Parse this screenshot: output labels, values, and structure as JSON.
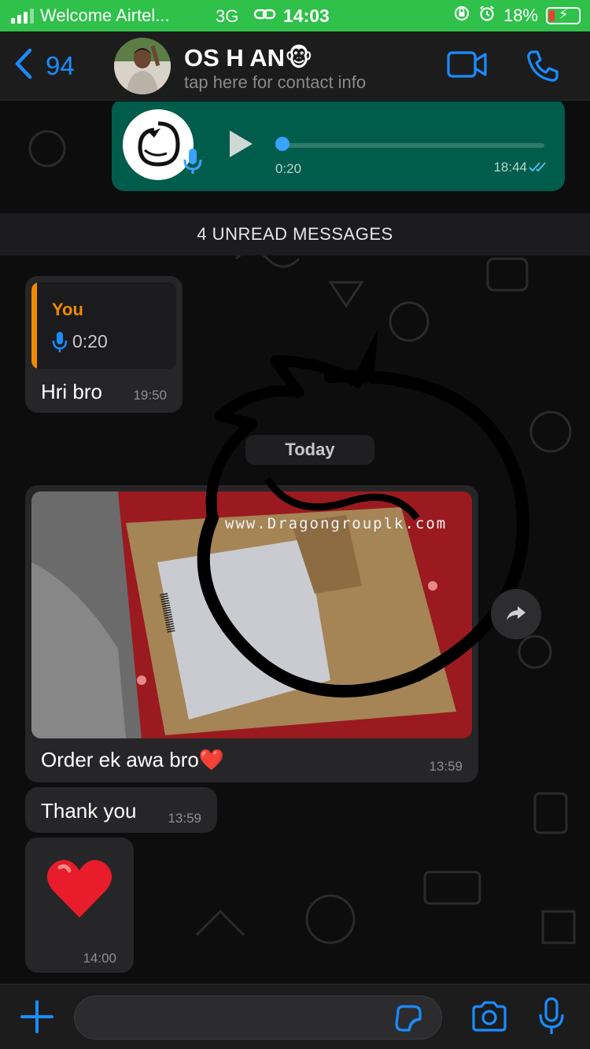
{
  "status_bar": {
    "carrier": "Welcome Airtel...",
    "network": "3G",
    "time": "14:03",
    "battery": "18%"
  },
  "header": {
    "back_count": "94",
    "contact_name": "OS H AN🐵",
    "subtitle": "tap here for contact info"
  },
  "messages": {
    "voice_out": {
      "duration": "0:20",
      "time": "18:44"
    },
    "unread_banner": "4 UNREAD MESSAGES",
    "reply": {
      "quote_author": "You",
      "quote_duration": "0:20",
      "text": "Hri bro",
      "time": "19:50"
    },
    "date_separator": "Today",
    "photo": {
      "watermark": "www.Dragongrouplk.com",
      "caption": "Order ek awa bro❤️",
      "time": "13:59"
    },
    "thanks": {
      "text": "Thank you",
      "time": "13:59"
    },
    "heart": {
      "time": "14:00"
    }
  },
  "colors": {
    "accent": "#1a8cff",
    "status_bar": "#2fc14a",
    "outgoing_bubble": "#005c4b",
    "incoming_bubble": "#262628",
    "quote_author": "#f08a00"
  }
}
